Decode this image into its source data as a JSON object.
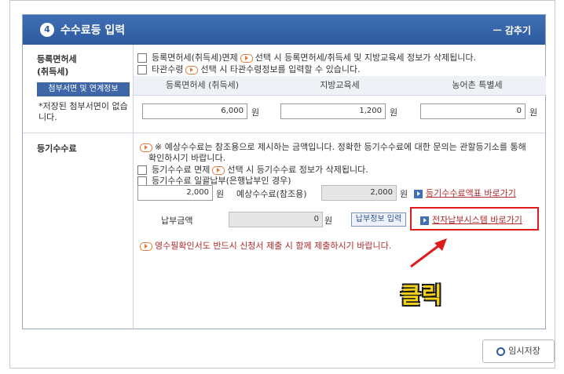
{
  "panel": {
    "number": "4",
    "title": "수수료등 입력",
    "collapse_label": "ㅡ 감추기"
  },
  "registration_tax": {
    "label_line1": "등록면허세",
    "label_line2": "(취득세)",
    "attach_button": "첨부서면 및 연계정보",
    "note": "*저장된 첨부서면이 없습니다.",
    "checkbox1_text_a": "등록면허세(취득세)면제",
    "checkbox1_text_b": "선택 시 등록면허세/취득세 및 지방교육세 정보가 삭제됩니다.",
    "checkbox2_text_a": "타관수령",
    "checkbox2_text_b": "선택 시 타관수령정보를 입력할 수 있습니다.",
    "columns": [
      "등록면허세 (취득세)",
      "지방교육세",
      "농어촌 특별세"
    ],
    "values": [
      "6,000",
      "1,200",
      "0"
    ],
    "unit": "원"
  },
  "registration_fee": {
    "label": "등기수수료",
    "notice": "※ 예상수수료는 참조용으로 제시하는 금액입니다. 정확한 등기수수료에 대한 문의는 관할등기소를 통해",
    "notice2": "확인하시기 바랍니다.",
    "exempt_a": "등기수수료 면제",
    "exempt_b": "선택 시 등기수수료 정보가 삭제됩니다.",
    "bulk_payment": "등기수수료 일괄납부(은행납부인 경우)",
    "fee_value": "2,000",
    "unit": "원",
    "expected_label": "예상수수료(참조용)",
    "expected_value": "2,000",
    "fee_table_link": "등기수수료액표 바로가기",
    "payment_amount_label": "납부금액",
    "payment_amount_value": "0",
    "payment_unit": "원",
    "payment_info_button": "납부정보 입력",
    "e_payment_link": "전자납부시스템 바로가기",
    "receipt_note": "영수필확인서도 반드시 신청서 제출 시 함께 제출하시기 바랍니다."
  },
  "annotation": {
    "click_text": "클릭"
  },
  "footer": {
    "save_label": "임시저장"
  },
  "colors": {
    "header_blue": "#2d5aa0",
    "highlight_red": "#e01b1b",
    "link_red": "#b02a2a",
    "label_yellow": "#f5d21a"
  }
}
